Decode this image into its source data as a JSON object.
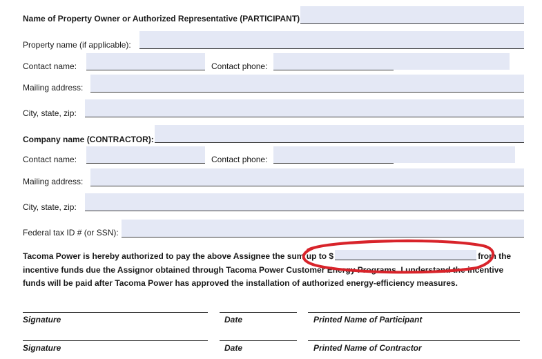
{
  "participant": {
    "heading": "Name of Property Owner or Authorized Representative (PARTICIPANT):",
    "property_name_label": "Property name (if applicable):",
    "contact_name_label": "Contact name:",
    "contact_phone_label": "Contact phone:",
    "mailing_address_label": "Mailing address:",
    "city_state_zip_label": "City, state, zip:"
  },
  "contractor": {
    "heading": "Company name (CONTRACTOR):",
    "contact_name_label": "Contact name:",
    "contact_phone_label": "Contact phone:",
    "mailing_address_label": "Mailing address:",
    "city_state_zip_label": "City, state, zip:",
    "tax_id_label": "Federal tax ID # (or SSN):"
  },
  "authorization": {
    "text_before": "Tacoma Power is hereby authorized to pay the above Assignee the sum up to $",
    "text_after": "from the incentive funds due the Assignor obtained through Tacoma Power Customer Energy Programs. I understand the incentive funds will be paid after Tacoma Power has approved the installation of authorized energy-efficiency measures."
  },
  "signatures": {
    "row1": {
      "signature": "Signature",
      "date": "Date",
      "printed_name": "Printed Name of Participant"
    },
    "row2": {
      "signature": "Signature",
      "date": "Date",
      "printed_name": "Printed Name of Contractor"
    }
  },
  "annotation": {
    "color": "#d8232a"
  }
}
